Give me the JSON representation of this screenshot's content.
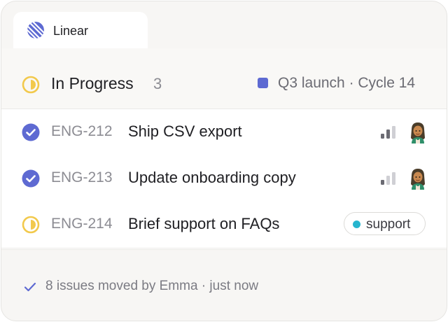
{
  "app": {
    "tab_label": "Linear",
    "logo_icon": "linear-logo-icon",
    "brand_color": "#5e6ad2"
  },
  "group": {
    "title": "In Progress",
    "count": "3",
    "status_icon": "in-progress-icon",
    "status_color": "#f2c94c",
    "cycle_label": "Q3 launch · Cycle 14",
    "cycle_color": "#5e6ad2"
  },
  "issues": [
    {
      "id": "ENG-212",
      "title": "Ship CSV export",
      "status": "done",
      "status_icon": "done-check-icon",
      "priority_icon": "priority-medium-icon",
      "priority_level": 2,
      "assignee_icon": "avatar-icon"
    },
    {
      "id": "ENG-213",
      "title": "Update onboarding copy",
      "status": "done",
      "status_icon": "done-check-icon",
      "priority_icon": "priority-low-icon",
      "priority_level": 1,
      "assignee_icon": "avatar-icon"
    },
    {
      "id": "ENG-214",
      "title": "Brief support on FAQs",
      "status": "in-progress",
      "status_icon": "in-progress-icon",
      "label": "support",
      "label_color": "#26b5ce"
    }
  ],
  "footer": {
    "text": "8 issues moved by Emma · just now",
    "icon": "check-icon"
  }
}
